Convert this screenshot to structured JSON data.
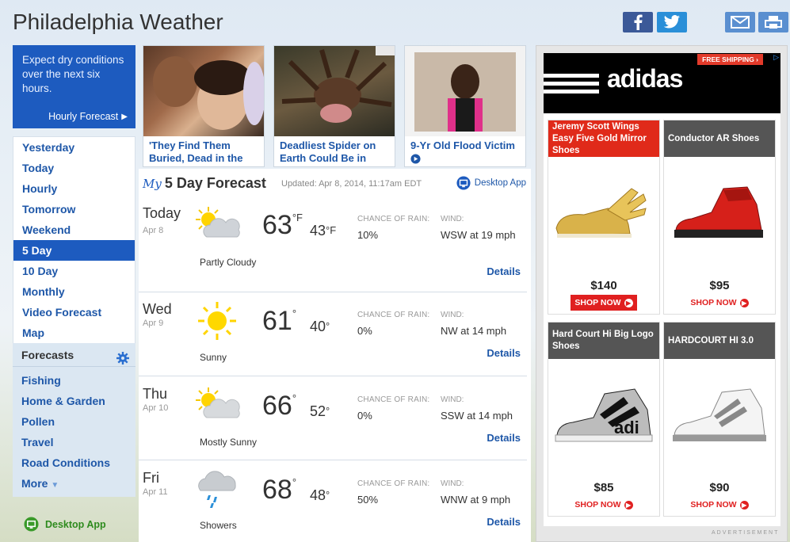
{
  "page": {
    "title": "Philadelphia Weather"
  },
  "share": {
    "facebook_icon": "facebook-icon",
    "twitter_icon": "twitter-icon",
    "email_icon": "email-icon",
    "print_icon": "print-icon"
  },
  "alert": {
    "text": "Expect dry conditions over the next six hours.",
    "link": "Hourly Forecast"
  },
  "nav": {
    "items": [
      {
        "label": "Yesterday"
      },
      {
        "label": "Today"
      },
      {
        "label": "Hourly"
      },
      {
        "label": "Tomorrow"
      },
      {
        "label": "Weekend"
      },
      {
        "label": "5 Day"
      },
      {
        "label": "10 Day"
      },
      {
        "label": "Monthly"
      },
      {
        "label": "Video Forecast"
      },
      {
        "label": "Map"
      }
    ],
    "active": "5 Day"
  },
  "forecasts": {
    "title": "Forecasts",
    "items": [
      {
        "label": "Fishing"
      },
      {
        "label": "Home & Garden"
      },
      {
        "label": "Pollen"
      },
      {
        "label": "Travel"
      },
      {
        "label": "Road Conditions"
      },
      {
        "label": "More"
      }
    ]
  },
  "desktop_app_left": "Desktop App",
  "news": [
    {
      "caption": "'They Find Them Buried, Dead in the Sand'"
    },
    {
      "caption": "Deadliest Spider on Earth Could Be in Your House"
    },
    {
      "caption": "9-Yr Old Flood Victim"
    }
  ],
  "forecast": {
    "my": "My",
    "title": "5 Day Forecast",
    "updated": "Updated: Apr 8, 2014, 11:17am EDT",
    "desktop_app": "Desktop App",
    "rain_label": "CHANCE OF RAIN:",
    "wind_label": "WIND:",
    "details_label": "Details",
    "days": [
      {
        "name": "Today",
        "date": "Apr 8",
        "cond": "Partly Cloudy",
        "hi": "63",
        "hi_unit": "°F",
        "lo": "43",
        "lo_unit": "°F",
        "rain": "10%",
        "wind": "WSW at 19 mph",
        "icon": "partly-cloudy-icon"
      },
      {
        "name": "Wed",
        "date": "Apr 9",
        "cond": "Sunny",
        "hi": "61",
        "hi_unit": "°",
        "lo": "40",
        "lo_unit": "°",
        "rain": "0%",
        "wind": "NW at 14 mph",
        "icon": "sunny-icon"
      },
      {
        "name": "Thu",
        "date": "Apr 10",
        "cond": "Mostly Sunny",
        "hi": "66",
        "hi_unit": "°",
        "lo": "52",
        "lo_unit": "°",
        "rain": "0%",
        "wind": "SSW at 14 mph",
        "icon": "mostly-sunny-icon"
      },
      {
        "name": "Fri",
        "date": "Apr 11",
        "cond": "Showers",
        "hi": "68",
        "hi_unit": "°",
        "lo": "48",
        "lo_unit": "°",
        "rain": "50%",
        "wind": "WNW at 9 mph",
        "icon": "showers-icon"
      }
    ]
  },
  "ad": {
    "free_shipping": "FREE SHIPPING ›",
    "brand": "adidas",
    "label": "ADVERTISEMENT",
    "products": [
      {
        "title": "Jeremy Scott Wings Easy Five Gold Mirror Shoes",
        "price": "$140",
        "shop": "SHOP NOW",
        "title_bg": "#e02a1a",
        "filled": true
      },
      {
        "title": "Conductor AR Shoes",
        "price": "$95",
        "shop": "SHOP NOW",
        "title_bg": "#555555",
        "filled": false
      },
      {
        "title": "Hard Court Hi Big Logo Shoes",
        "price": "$85",
        "shop": "SHOP NOW",
        "title_bg": "#555555",
        "filled": false
      },
      {
        "title": "HARDCOURT HI 3.0",
        "price": "$90",
        "shop": "SHOP NOW",
        "title_bg": "#555555",
        "filled": false
      }
    ]
  }
}
